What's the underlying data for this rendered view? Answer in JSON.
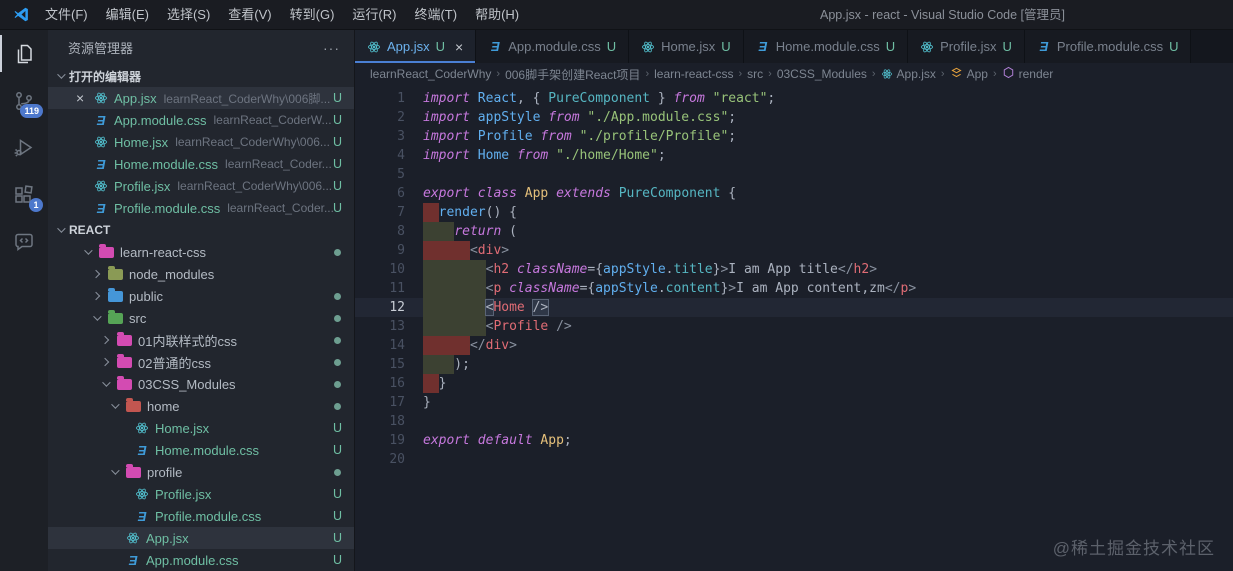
{
  "title_bar": {
    "menus": [
      "文件(F)",
      "编辑(E)",
      "选择(S)",
      "查看(V)",
      "转到(G)",
      "运行(R)",
      "终端(T)",
      "帮助(H)"
    ],
    "title": "App.jsx - react - Visual Studio Code [管理员]"
  },
  "activity_bar": {
    "scm_badge": "119",
    "extensions_badge": "1"
  },
  "icons": {
    "close": "×",
    "more": "···",
    "css_glyph": "Ǝ",
    "crumb_sep": "›"
  },
  "colors": {
    "accent": "#4a7fd4",
    "badge": "#4d78cc",
    "untracked": "#6fbfa4",
    "react_icon": "#52c1cf",
    "css_icon": "#3f9bd8",
    "folder_pink": "#d34bb2",
    "folder_olive": "#8a9a55",
    "folder_blue": "#4596d8",
    "folder_green": "#56a456",
    "folder_red": "#c25650",
    "dot": "#6d9e90",
    "kw": "#c678dd",
    "ident": "#61afef",
    "type": "#56b6c2",
    "classname": "#e5c07b",
    "string": "#98c379",
    "tag": "#e06c75",
    "text": "#abb2bf",
    "indent_red": "#70302e",
    "indent_olive": "#3c4132"
  },
  "sidebar": {
    "header": "资源管理器",
    "open_editors_label": "打开的编辑器",
    "section_label": "REACT",
    "open_editors": [
      {
        "name": "App.jsx",
        "desc": "learnReact_CoderWhy\\006脚...",
        "icon": "react",
        "status": "U",
        "active": true
      },
      {
        "name": "App.module.css",
        "desc": "learnReact_CoderW...",
        "icon": "css",
        "status": "U"
      },
      {
        "name": "Home.jsx",
        "desc": "learnReact_CoderWhy\\006...",
        "icon": "react",
        "status": "U"
      },
      {
        "name": "Home.module.css",
        "desc": "learnReact_Coder...",
        "icon": "css",
        "status": "U"
      },
      {
        "name": "Profile.jsx",
        "desc": "learnReact_CoderWhy\\006...",
        "icon": "react",
        "status": "U"
      },
      {
        "name": "Profile.module.css",
        "desc": "learnReact_Coder...",
        "icon": "css",
        "status": "U"
      }
    ],
    "tree": [
      {
        "label": "learn-react-css",
        "icon": "folder",
        "color": "pink",
        "lvl": 1,
        "chev": "open",
        "dot": true
      },
      {
        "label": "node_modules",
        "icon": "folder",
        "color": "olive",
        "lvl": 2,
        "chev": "closed"
      },
      {
        "label": "public",
        "icon": "folder",
        "color": "blue",
        "lvl": 2,
        "chev": "closed",
        "dot": true
      },
      {
        "label": "src",
        "icon": "folder",
        "color": "green",
        "lvl": 2,
        "chev": "open",
        "dot": true
      },
      {
        "label": "01内联样式的css",
        "icon": "folder",
        "color": "pink",
        "lvl": 3,
        "chev": "closed",
        "dot": true
      },
      {
        "label": "02普通的css",
        "icon": "folder",
        "color": "pink",
        "lvl": 3,
        "chev": "closed",
        "dot": true
      },
      {
        "label": "03CSS_Modules",
        "icon": "folder",
        "color": "pink",
        "lvl": 3,
        "chev": "open",
        "dot": true
      },
      {
        "label": "home",
        "icon": "folder",
        "color": "red",
        "lvl": 4,
        "chev": "open",
        "dot": true
      },
      {
        "label": "Home.jsx",
        "icon": "react",
        "lvl": 5,
        "status": "U"
      },
      {
        "label": "Home.module.css",
        "icon": "css",
        "lvl": 5,
        "status": "U"
      },
      {
        "label": "profile",
        "icon": "folder",
        "color": "pink",
        "lvl": 4,
        "chev": "open",
        "dot": true
      },
      {
        "label": "Profile.jsx",
        "icon": "react",
        "lvl": 5,
        "status": "U"
      },
      {
        "label": "Profile.module.css",
        "icon": "css",
        "lvl": 5,
        "status": "U"
      },
      {
        "label": "App.jsx",
        "icon": "react",
        "lvl": 4,
        "status": "U",
        "selected": true
      },
      {
        "label": "App.module.css",
        "icon": "css",
        "lvl": 4,
        "status": "U"
      }
    ]
  },
  "tabs": [
    {
      "label": "App.jsx",
      "status": "U",
      "icon": "react",
      "active": true,
      "close": true
    },
    {
      "label": "App.module.css",
      "status": "U",
      "icon": "css"
    },
    {
      "label": "Home.jsx",
      "status": "U",
      "icon": "react"
    },
    {
      "label": "Home.module.css",
      "status": "U",
      "icon": "css"
    },
    {
      "label": "Profile.jsx",
      "status": "U",
      "icon": "react"
    },
    {
      "label": "Profile.module.css",
      "status": "U",
      "icon": "css"
    }
  ],
  "breadcrumb": [
    {
      "label": "learnReact_CoderWhy"
    },
    {
      "label": "006脚手架创建React项目"
    },
    {
      "label": "learn-react-css"
    },
    {
      "label": "src"
    },
    {
      "label": "03CSS_Modules"
    },
    {
      "label": "App.jsx",
      "icon": "react"
    },
    {
      "label": "App",
      "icon": "class"
    },
    {
      "label": "render",
      "icon": "method"
    }
  ],
  "editor": {
    "lines": [
      {
        "t": [
          [
            "kw",
            "import"
          ],
          [
            "pl",
            " "
          ],
          [
            "blue",
            "React"
          ],
          [
            "pl",
            ", { "
          ],
          [
            "teal",
            "PureComponent"
          ],
          [
            "pl",
            " } "
          ],
          [
            "kw",
            "from"
          ],
          [
            "pl",
            " "
          ],
          [
            "str",
            "\"react\""
          ],
          [
            "pl",
            ";"
          ]
        ]
      },
      {
        "t": [
          [
            "kw",
            "import"
          ],
          [
            "pl",
            " "
          ],
          [
            "blue",
            "appStyle"
          ],
          [
            "pl",
            " "
          ],
          [
            "kw",
            "from"
          ],
          [
            "pl",
            " "
          ],
          [
            "str",
            "\"./App.module.css\""
          ],
          [
            "pl",
            ";"
          ]
        ]
      },
      {
        "t": [
          [
            "kw",
            "import"
          ],
          [
            "pl",
            " "
          ],
          [
            "blue",
            "Profile"
          ],
          [
            "pl",
            " "
          ],
          [
            "kw",
            "from"
          ],
          [
            "pl",
            " "
          ],
          [
            "str",
            "\"./profile/Profile\""
          ],
          [
            "pl",
            ";"
          ]
        ]
      },
      {
        "t": [
          [
            "kw",
            "import"
          ],
          [
            "pl",
            " "
          ],
          [
            "blue",
            "Home"
          ],
          [
            "pl",
            " "
          ],
          [
            "kw",
            "from"
          ],
          [
            "pl",
            " "
          ],
          [
            "str",
            "\"./home/Home\""
          ],
          [
            "pl",
            ";"
          ]
        ]
      },
      {
        "t": []
      },
      {
        "t": [
          [
            "kw",
            "export"
          ],
          [
            "pl",
            " "
          ],
          [
            "kw",
            "class"
          ],
          [
            "pl",
            " "
          ],
          [
            "yel",
            "App"
          ],
          [
            "pl",
            " "
          ],
          [
            "kw",
            "extends"
          ],
          [
            "pl",
            " "
          ],
          [
            "teal",
            "PureComponent"
          ],
          [
            "pl",
            " {"
          ]
        ]
      },
      {
        "t": [
          [
            "pl",
            "  "
          ],
          [
            "blue",
            "render"
          ],
          [
            "pl",
            "() {"
          ]
        ],
        "b": [
          "red",
          16
        ]
      },
      {
        "t": [
          [
            "pl",
            "    "
          ],
          [
            "kw",
            "return"
          ],
          [
            "pl",
            " ("
          ]
        ],
        "b": [
          "olive",
          31
        ]
      },
      {
        "t": [
          [
            "pl",
            "      "
          ],
          [
            "ang",
            "<"
          ],
          [
            "tag",
            "div"
          ],
          [
            "ang",
            ">"
          ]
        ],
        "b": [
          "red",
          47
        ]
      },
      {
        "t": [
          [
            "pl",
            "        "
          ],
          [
            "ang",
            "<"
          ],
          [
            "tag",
            "h2"
          ],
          [
            "pl",
            " "
          ],
          [
            "attr",
            "className"
          ],
          [
            "pl",
            "={"
          ],
          [
            "blue",
            "appStyle"
          ],
          [
            "pl",
            "."
          ],
          [
            "teal",
            "title"
          ],
          [
            "pl",
            "}"
          ],
          [
            "ang",
            ">"
          ],
          [
            "pl",
            "I am App title"
          ],
          [
            "ang",
            "</"
          ],
          [
            "tag",
            "h2"
          ],
          [
            "ang",
            ">"
          ]
        ],
        "b": [
          "olive",
          63
        ]
      },
      {
        "t": [
          [
            "pl",
            "        "
          ],
          [
            "ang",
            "<"
          ],
          [
            "tag",
            "p"
          ],
          [
            "pl",
            " "
          ],
          [
            "attr",
            "className"
          ],
          [
            "pl",
            "={"
          ],
          [
            "blue",
            "appStyle"
          ],
          [
            "pl",
            "."
          ],
          [
            "teal",
            "content"
          ],
          [
            "pl",
            "}"
          ],
          [
            "ang",
            ">"
          ],
          [
            "pl",
            "I am App content,zm"
          ],
          [
            "ang",
            "</"
          ],
          [
            "tag",
            "p"
          ],
          [
            "ang",
            ">"
          ]
        ],
        "b": [
          "olive",
          63
        ]
      },
      {
        "t": [
          [
            "pl",
            "        "
          ],
          [
            "box",
            "<"
          ],
          [
            "tag",
            "Home"
          ],
          [
            "pl",
            " "
          ],
          [
            "box",
            "/>"
          ]
        ],
        "b": [
          "olive",
          63
        ],
        "cur": true
      },
      {
        "t": [
          [
            "pl",
            "        "
          ],
          [
            "ang",
            "<"
          ],
          [
            "tag",
            "Profile"
          ],
          [
            "pl",
            " "
          ],
          [
            "ang",
            "/>"
          ]
        ],
        "b": [
          "olive",
          63
        ]
      },
      {
        "t": [
          [
            "pl",
            "      "
          ],
          [
            "ang",
            "</"
          ],
          [
            "tag",
            "div"
          ],
          [
            "ang",
            ">"
          ]
        ],
        "b": [
          "red",
          47
        ]
      },
      {
        "t": [
          [
            "pl",
            "    );"
          ]
        ],
        "b": [
          "olive",
          31
        ]
      },
      {
        "t": [
          [
            "pl",
            "  }"
          ]
        ],
        "b": [
          "red",
          16
        ]
      },
      {
        "t": [
          [
            "pl",
            "}"
          ]
        ]
      },
      {
        "t": []
      },
      {
        "t": [
          [
            "kw",
            "export"
          ],
          [
            "pl",
            " "
          ],
          [
            "kw",
            "default"
          ],
          [
            "pl",
            " "
          ],
          [
            "yel",
            "App"
          ],
          [
            "pl",
            ";"
          ]
        ]
      },
      {
        "t": []
      }
    ]
  },
  "watermark": "@稀土掘金技术社区"
}
